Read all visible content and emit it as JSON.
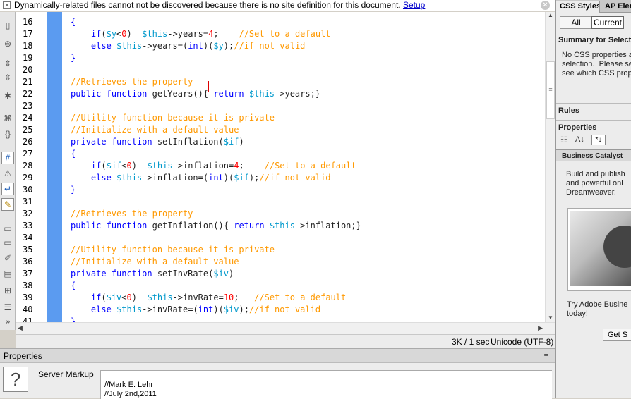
{
  "infobar": {
    "message": "Dynamically-related files cannot not be discovered because there is no site definition for this document.",
    "link": "Setup"
  },
  "line_numbers": [
    "16",
    "17",
    "18",
    "19",
    "20",
    "21",
    "22",
    "23",
    "24",
    "25",
    "26",
    "27",
    "28",
    "29",
    "30",
    "31",
    "32",
    "33",
    "34",
    "35",
    "36",
    "37",
    "38",
    "39",
    "40",
    "41"
  ],
  "status": {
    "size_time": "3K / 1 sec",
    "encoding": "Unicode (UTF-8)"
  },
  "properties": {
    "title": "Properties",
    "label": "Server Markup",
    "line1": "//Mark E. Lehr",
    "line2": "//July 2nd,2011",
    "icon": "question-icon"
  },
  "panel": {
    "tab1": "CSS Styles",
    "tab2": "AP Elem",
    "all": "All",
    "current": "Current",
    "summary_title": "Summary for Selectio",
    "summary_text": "No CSS properties ap\nselection.  Please sel\nsee which CSS prope",
    "rules": "Rules",
    "properties": "Properties",
    "bc_tab": "Business Catalyst",
    "bc_text": "Build and publish\nand powerful onl\nDreamweaver.",
    "bc_try": "Try Adobe Busine\ntoday!",
    "bc_button": "Get S"
  },
  "icons": [
    "file-icon",
    "globe-icon",
    "collapse-full-tag-icon",
    "collapse-selection-icon",
    "expand-all-icon",
    "select-parent-icon",
    "balance-braces-icon",
    "line-numbers-icon",
    "highlight-invalid-icon",
    "word-wrap-icon",
    "syntax-coloring-icon",
    "apply-comment-icon",
    "remove-comment-icon",
    "wrap-tag-icon",
    "recent-snippets-icon",
    "indent-icon",
    "format-source-icon",
    "more-icon"
  ]
}
